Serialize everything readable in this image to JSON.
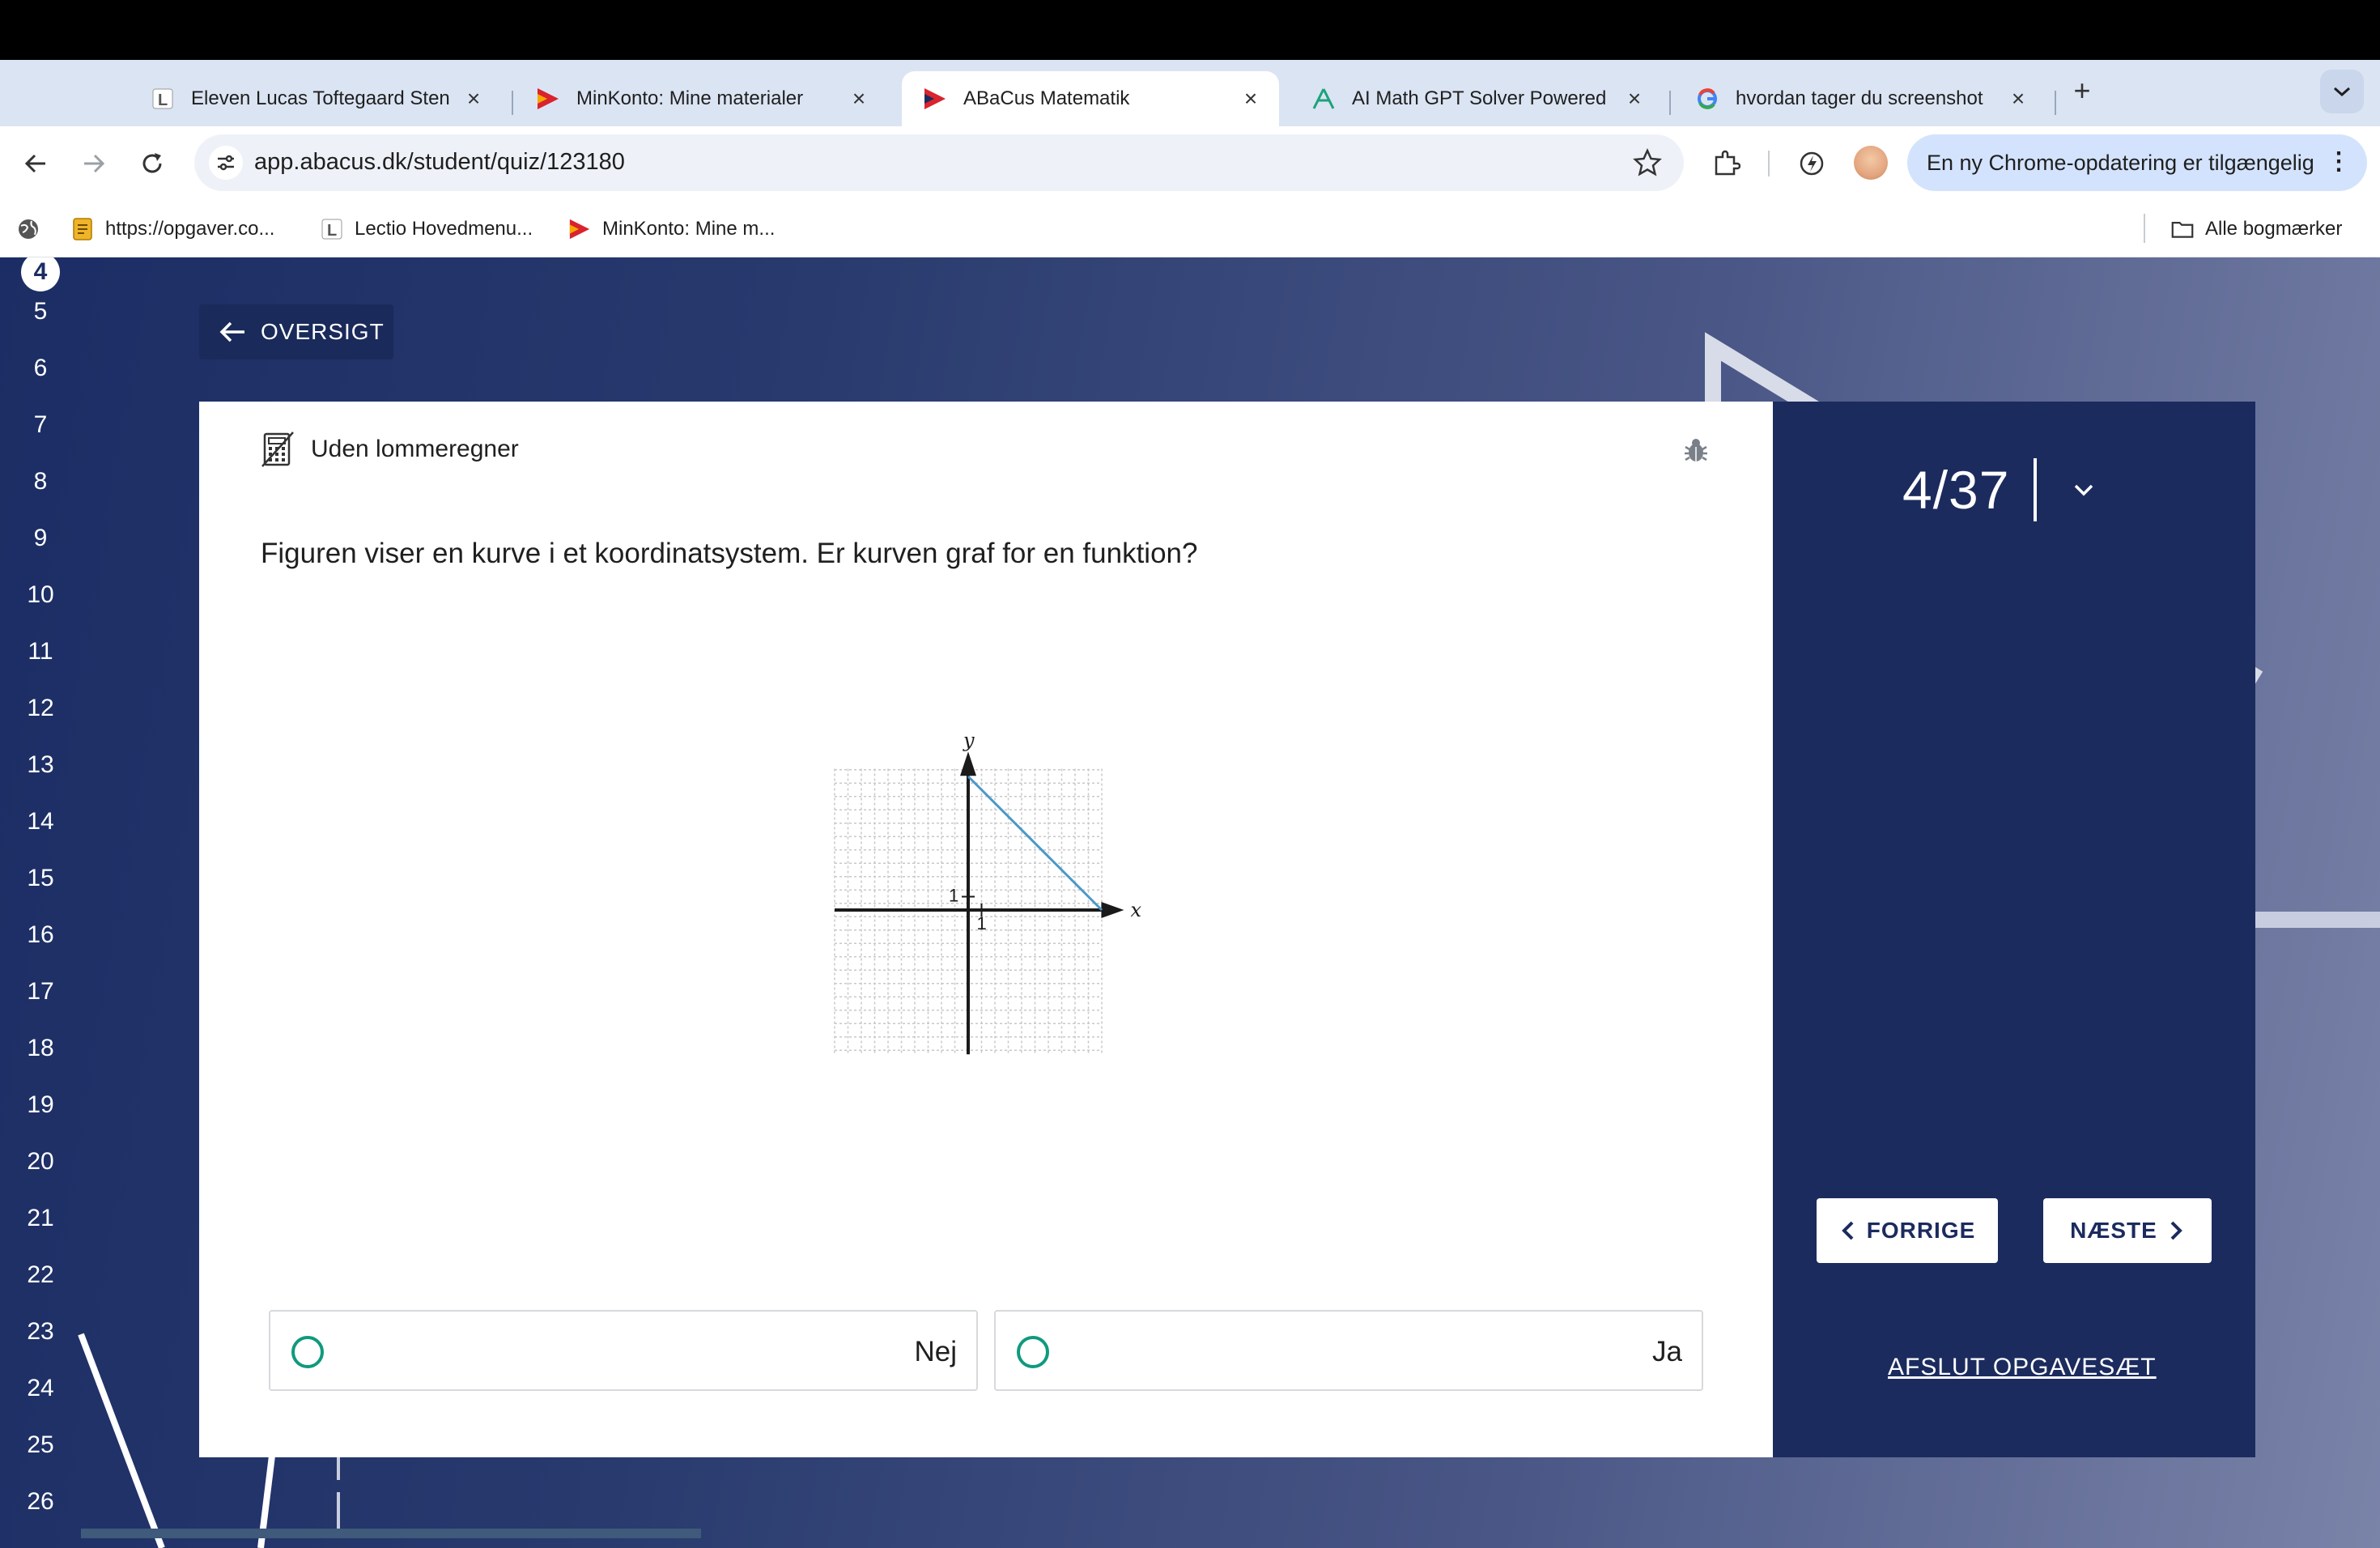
{
  "browser": {
    "tabs": [
      {
        "title": "Eleven Lucas Toftegaard Sten",
        "icon": "lectio-icon",
        "active": false
      },
      {
        "title": "MinKonto: Mine materialer",
        "icon": "minkonto-icon",
        "active": false
      },
      {
        "title": "ABaCus Matematik",
        "icon": "abacus-icon",
        "active": true
      },
      {
        "title": "AI Math GPT Solver Powered",
        "icon": "mathgpt-icon",
        "active": false
      },
      {
        "title": "hvordan tager du screenshot",
        "icon": "google-icon",
        "active": false
      }
    ],
    "url": "app.abacus.dk/student/quiz/123180",
    "update_label": "En ny Chrome-opdatering er tilgængelig",
    "bookmarks": [
      {
        "label": "https://opgaver.co...",
        "icon": "document-icon"
      },
      {
        "label": "Lectio Hovedmenu...",
        "icon": "lectio-icon"
      },
      {
        "label": "MinKonto: Mine m...",
        "icon": "minkonto-icon"
      }
    ],
    "all_bookmarks_label": "Alle bogmærker"
  },
  "line_numbers": [
    "4",
    "5",
    "6",
    "7",
    "8",
    "9",
    "10",
    "11",
    "12",
    "13",
    "14",
    "15",
    "16",
    "17",
    "18",
    "19",
    "20",
    "21",
    "22",
    "23",
    "24",
    "25",
    "26"
  ],
  "quiz": {
    "back_label": "OVERSIGT",
    "calculator_label": "Uden lommeregner",
    "question": "Figuren viser en kurve i et koordinatsystem. Er kurven graf for en funktion?",
    "options": [
      "Nej",
      "Ja"
    ],
    "progress": "4/37",
    "prev_label": "FORRIGE",
    "next_label": "NÆSTE",
    "finish_label": "AFSLUT OPGAVESÆT"
  },
  "figure": {
    "x_axis_label": "x",
    "y_axis_label": "y",
    "x_tick_label": "1",
    "y_tick_label": "1",
    "grid_range": {
      "x": [
        -10,
        10
      ],
      "y": [
        -10,
        10
      ]
    },
    "segment": {
      "from": [
        0,
        10
      ],
      "to": [
        10,
        0
      ]
    },
    "curve_color": "#4a98c8",
    "grid_color": "#c8c8c8",
    "axis_color": "#1a1a1a"
  },
  "colors": {
    "accent_teal": "#0f9a7e",
    "panel_navy": "#1b2b5e"
  }
}
